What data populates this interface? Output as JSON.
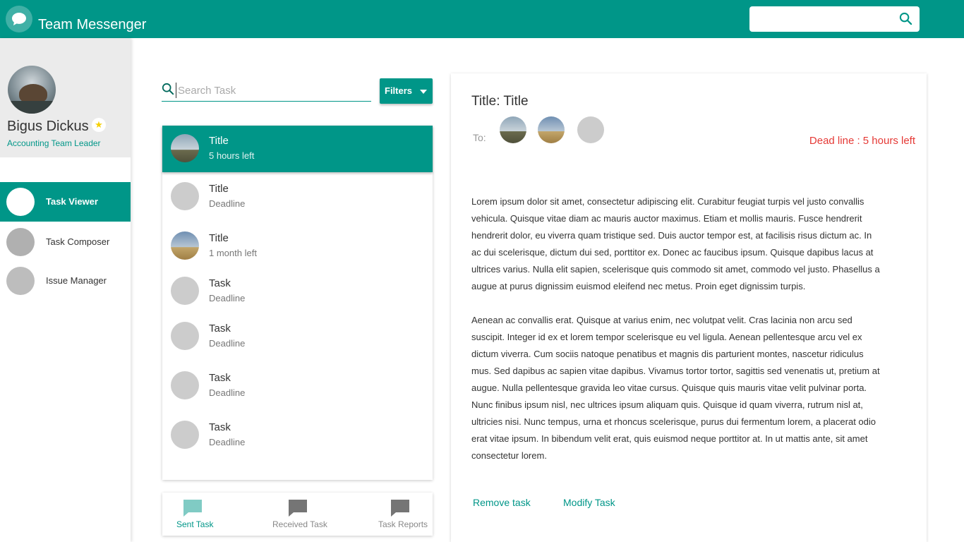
{
  "header": {
    "app_title": "Team Messenger",
    "logo_icon": "chat-bubble-icon",
    "search_placeholder": "",
    "search_icon": "search-icon",
    "brand_color": "#009688"
  },
  "sidebar": {
    "profile": {
      "name": "Bigus Dickus",
      "role": "Accounting Team Leader",
      "badge_icon": "star-icon"
    },
    "items": [
      {
        "label": "Task Viewer",
        "active": true
      },
      {
        "label": "Task Composer",
        "active": false
      },
      {
        "label": "Issue Manager",
        "active": false
      }
    ]
  },
  "task_panel": {
    "search_placeholder": "Search Task",
    "search_value": "",
    "filters_label": "Filters",
    "tasks": [
      {
        "title": "Title",
        "subtitle": "5 hours left",
        "active": true
      },
      {
        "title": "Title",
        "subtitle": "Deadline",
        "active": false
      },
      {
        "title": "Title",
        "subtitle": "1 month left",
        "active": false
      },
      {
        "title": "Task",
        "subtitle": "Deadline",
        "active": false
      },
      {
        "title": "Task",
        "subtitle": "Deadline",
        "active": false
      },
      {
        "title": "Task",
        "subtitle": "Deadline",
        "active": false
      },
      {
        "title": "Task",
        "subtitle": "Deadline",
        "active": false
      }
    ],
    "bottom_tabs": [
      {
        "label": "Sent Task",
        "active": true
      },
      {
        "label": "Received Task",
        "active": false
      },
      {
        "label": "Task Reports",
        "active": false
      }
    ]
  },
  "detail": {
    "title": "Title: Title",
    "to_label": "To:",
    "deadline": "Dead line : 5 hours left",
    "body_1": "Lorem ipsum dolor sit amet, consectetur adipiscing elit. Curabitur feugiat turpis vel justo convallis vehicula. Quisque vitae diam ac mauris auctor maximus. Etiam et mollis mauris. Fusce hendrerit hendrerit dolor, eu viverra quam tristique sed. Duis auctor tempor est, at facilisis risus dictum ac. In ac dui scelerisque, dictum dui sed, porttitor ex. Donec ac faucibus ipsum. Quisque dapibus lacus at ultrices varius. Nulla elit sapien, scelerisque quis commodo sit amet, commodo vel justo. Phasellus a augue at purus dignissim euismod eleifend nec metus. Proin eget dignissim turpis.",
    "body_2": "Aenean ac convallis erat. Quisque at varius enim, nec volutpat velit. Cras lacinia non arcu sed suscipit. Integer id ex et lorem tempor scelerisque eu vel ligula. Aenean pellentesque arcu vel ex dictum viverra. Cum sociis natoque penatibus et magnis dis parturient montes, nascetur ridiculus mus. Sed dapibus ac sapien vitae dapibus. Vivamus tortor tortor, sagittis sed venenatis ut, pretium at augue. Nulla pellentesque gravida leo vitae cursus. Quisque quis mauris vitae velit pulvinar porta. Nunc finibus ipsum nisl, nec ultrices ipsum aliquam quis. Quisque id quam viverra, rutrum nisl at, ultricies nisi. Nunc tempus, urna et rhoncus scelerisque, purus dui fermentum lorem, a placerat odio erat vitae ipsum. In bibendum velit erat, quis euismod neque porttitor at. In ut mattis ante, sit amet consectetur lorem.",
    "remove_label": "Remove task",
    "modify_label": "Modify Task",
    "deadline_color": "#e53935"
  }
}
